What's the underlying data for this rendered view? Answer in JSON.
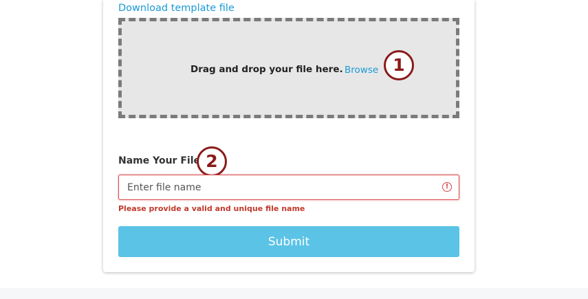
{
  "upload": {
    "template_link": "Download template file",
    "dropzone_text": "Drag and drop your file here.",
    "browse_label": "Browse"
  },
  "callouts": {
    "first": "1",
    "second": "2"
  },
  "file_name": {
    "label": "Name Your File",
    "placeholder": "Enter file name",
    "value": "",
    "error_icon": "!",
    "error_message": "Please provide a valid and unique file name"
  },
  "submit": {
    "label": "Submit"
  },
  "colors": {
    "link": "#1a9ad6",
    "error": "#c0392b",
    "submit": "#5bc3e6",
    "callout": "#8b1a1a"
  },
  "icons": {
    "error": "exclamation-circle-icon"
  }
}
